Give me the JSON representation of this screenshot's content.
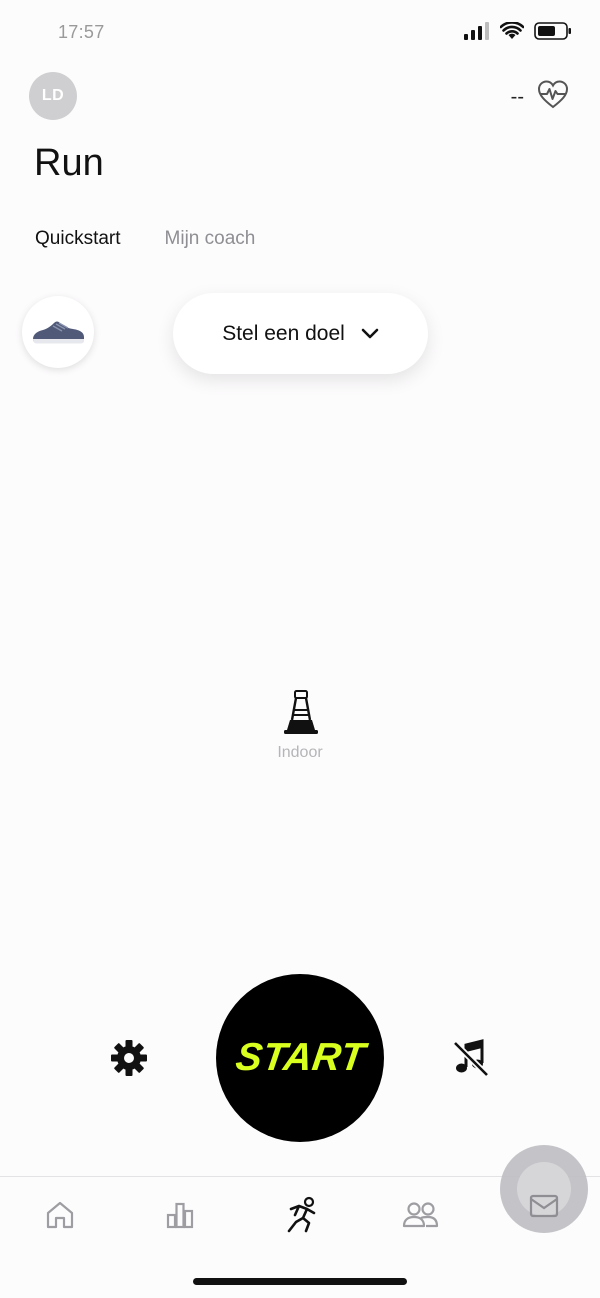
{
  "status_bar": {
    "time": "17:57"
  },
  "header": {
    "avatar_initials": "LD",
    "heart_rate": "--",
    "title": "Run"
  },
  "tabs": [
    {
      "label": "Quickstart",
      "active": true
    },
    {
      "label": "Mijn coach",
      "active": false
    }
  ],
  "goal": {
    "label": "Stel een doel"
  },
  "run_mode": {
    "label": "Indoor"
  },
  "controls": {
    "start_label": "START"
  },
  "nav": {
    "items": [
      "home-icon",
      "activity-icon",
      "run-icon",
      "club-icon",
      "inbox-icon"
    ],
    "active": "run-icon"
  },
  "colors": {
    "accent": "#d8ff1e",
    "start_bg": "#000000",
    "inactive_text": "#8e8e93"
  }
}
